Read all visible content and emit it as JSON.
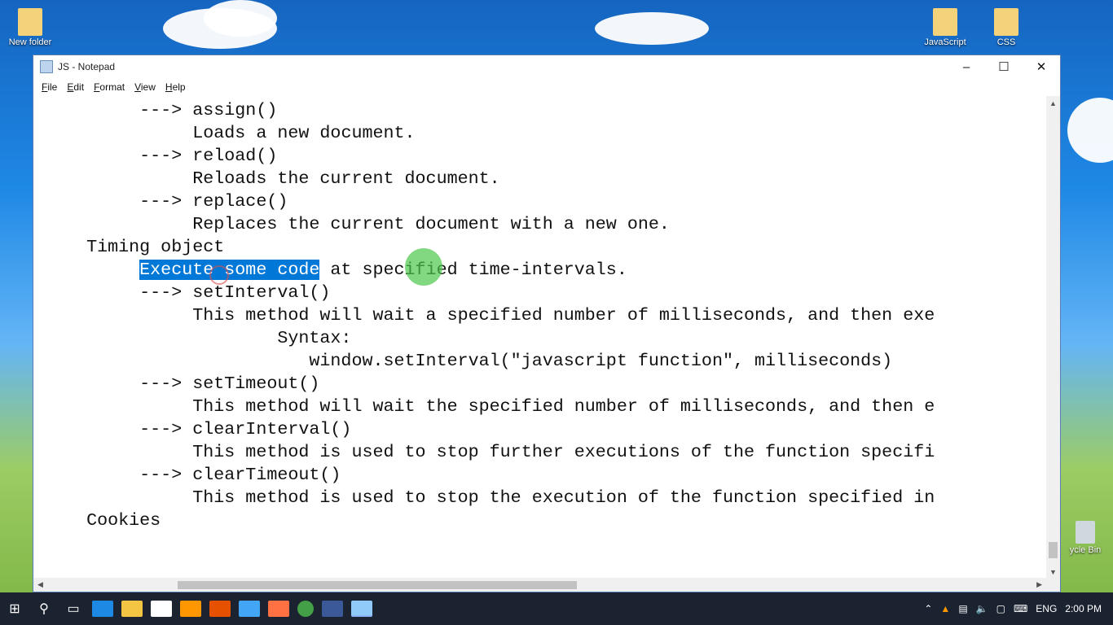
{
  "desktop": {
    "icons": [
      {
        "label": "New folder"
      },
      {
        "label": "JavaScript"
      },
      {
        "label": "CSS"
      },
      {
        "label": "ycle Bin"
      }
    ]
  },
  "window": {
    "title": "JS - Notepad",
    "controls": {
      "minimize": "–",
      "maximize": "☐",
      "close": "✕"
    },
    "menu": [
      "File",
      "Edit",
      "Format",
      "View",
      "Help"
    ]
  },
  "editor": {
    "lines": [
      {
        "indent": "          ",
        "text": "---> assign()"
      },
      {
        "indent": "               ",
        "text": "Loads a new document."
      },
      {
        "indent": "          ",
        "text": "---> reload()"
      },
      {
        "indent": "               ",
        "text": "Reloads the current document."
      },
      {
        "indent": "          ",
        "text": "---> replace()"
      },
      {
        "indent": "               ",
        "text": "Replaces the current document with a new one."
      },
      {
        "indent": "     ",
        "text": "Timing object"
      },
      {
        "indent": "          ",
        "selected": "Execute some code",
        "text": " at specified time-intervals."
      },
      {
        "indent": "          ",
        "text": "---> setInterval()"
      },
      {
        "indent": "               ",
        "text": "This method will wait a specified number of milliseconds, and then exe"
      },
      {
        "indent": "                       ",
        "text": "Syntax:"
      },
      {
        "indent": "                          ",
        "text": "window.setInterval(\"javascript function\", milliseconds)"
      },
      {
        "indent": "          ",
        "text": "---> setTimeout()"
      },
      {
        "indent": "               ",
        "text": "This method will wait the specified number of milliseconds, and then e"
      },
      {
        "indent": "          ",
        "text": "---> clearInterval()"
      },
      {
        "indent": "               ",
        "text": "This method is used to stop further executions of the function specifi"
      },
      {
        "indent": "          ",
        "text": "---> clearTimeout()"
      },
      {
        "indent": "               ",
        "text": "This method is used to stop the execution of the function specified in"
      },
      {
        "indent": "     ",
        "text": "Cookies"
      }
    ]
  },
  "taskbar": {
    "language": "ENG",
    "time": "2:00 PM"
  }
}
